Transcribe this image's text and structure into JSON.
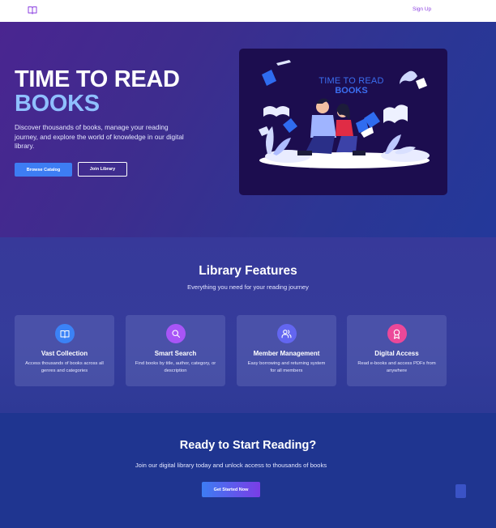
{
  "nav": {
    "logo_icon": "book-open-icon",
    "signup_label": "Sign Up"
  },
  "hero": {
    "title_line1": "TIME TO READ",
    "title_line2": "BOOKS",
    "description": "Discover thousands of books, manage your reading journey, and explore the world of knowledge in our digital library.",
    "browse_label": "Browse Catalog",
    "join_label": "Join Library",
    "illustration_title1": "TIME TO READ",
    "illustration_title2": "BOOKS"
  },
  "features": {
    "title": "Library Features",
    "subtitle": "Everything you need for your reading journey",
    "cards": [
      {
        "icon": "book-open-icon",
        "color": "#3b82f6",
        "title": "Vast Collection",
        "desc": "Access thousands of books across all genres and categories"
      },
      {
        "icon": "search-icon",
        "color": "#a855f7",
        "title": "Smart Search",
        "desc": "Find books by title, author, category, or description"
      },
      {
        "icon": "users-icon",
        "color": "#6366f1",
        "title": "Member Management",
        "desc": "Easy borrowing and returning system for all members"
      },
      {
        "icon": "award-icon",
        "color": "#ec4899",
        "title": "Digital Access",
        "desc": "Read e-books and access PDFs from anywhere"
      }
    ]
  },
  "cta": {
    "title": "Ready to Start Reading?",
    "subtitle": "Join our digital library today and unlock access to thousands of books",
    "button_label": "Get Started Now"
  }
}
